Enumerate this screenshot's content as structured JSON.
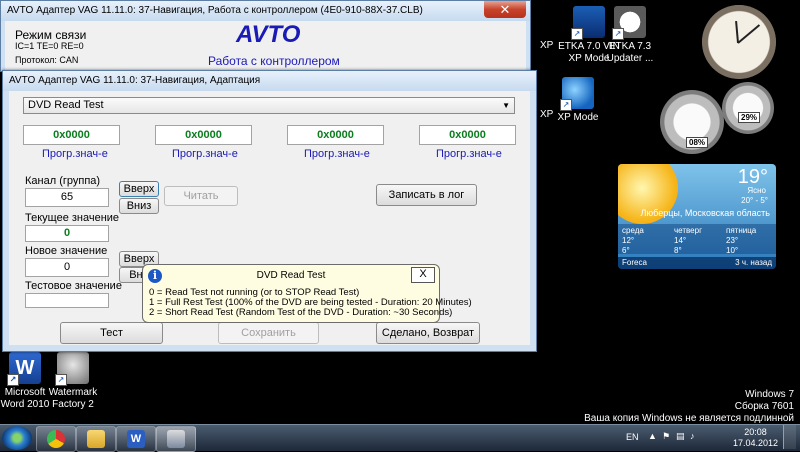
{
  "desktop": {
    "icons_top": [
      {
        "label_line1": "XP",
        "label_line2": ""
      },
      {
        "label_line1": "ETKA 7.0 VIN",
        "label_line2": "XP Mode"
      },
      {
        "label_line1": "ETKA 7.3",
        "label_line2": "Updater ..."
      }
    ],
    "icons_mid": [
      {
        "label": "XP"
      },
      {
        "label": "XP Mode"
      }
    ],
    "icons_bottom": [
      {
        "label_line1": "Microsoft",
        "label_line2": "Word 2010"
      },
      {
        "label_line1": "Watermark",
        "label_line2": "Factory 2"
      }
    ],
    "watermark": {
      "line1": "Windows 7",
      "line2": "Сборка 7601",
      "line3": "Ваша копия Windows не является подлинной"
    }
  },
  "gadgets": {
    "meter1_pct": "08%",
    "meter2_pct": "29%",
    "weather": {
      "temp": "19°",
      "condition": "Ясно",
      "range": "20° - 5°",
      "city": "Люберцы, Московская область",
      "days": [
        {
          "name": "среда",
          "hi": "12°",
          "lo": "6°"
        },
        {
          "name": "четверг",
          "hi": "14°",
          "lo": "8°"
        },
        {
          "name": "пятница",
          "hi": "23°",
          "lo": "10°"
        }
      ],
      "provider": "Foreca",
      "updated": "3 ч. назад"
    }
  },
  "taskbar": {
    "lang": "EN",
    "time": "20:08",
    "date": "17.04.2012"
  },
  "back_window": {
    "title": "AVTO Адаптер VAG 11.11.0: 37-Навигация,  Работа с контроллером (4E0-910-88X-37.CLB)",
    "conn_label": "Режим связи",
    "conn_values": "IC=1  TE=0  RE=0",
    "protocol": "Протокол: CAN",
    "logo": "AVTO",
    "subtitle": "Работа с контроллером"
  },
  "front_window": {
    "title": "AVTO Адаптер VAG 11.11.0: 37-Навигация,  Адаптация",
    "dropdown_value": "DVD Read Test",
    "values": [
      {
        "value": "0x0000",
        "caption": "Прогр.знач-е"
      },
      {
        "value": "0x0000",
        "caption": "Прогр.знач-е"
      },
      {
        "value": "0x0000",
        "caption": "Прогр.знач-е"
      },
      {
        "value": "0x0000",
        "caption": "Прогр.знач-е"
      }
    ],
    "channel_label": "Канал (группа)",
    "channel_value": "65",
    "up_label": "Вверх",
    "down_label": "Вниз",
    "read_label": "Читать",
    "log_label": "Записать в лог",
    "current_label": "Текущее значение",
    "current_value": "0",
    "new_label": "Новое значение",
    "new_value": "0",
    "up2_label": "Вверх",
    "down2_label": "Вни",
    "test_value_label": "Тестовое значение",
    "test_value": "",
    "test_button": "Тест",
    "save_button": "Сохранить",
    "done_button": "Сделано, Возврат"
  },
  "tooltip": {
    "title": "DVD Read Test",
    "close": "X",
    "lines": [
      "0 = Read Test not running (or to STOP Read Test)",
      "1 = Full Rest Test (100% of the DVD are being tested - Duration: 20 Minutes)",
      "2 = Short Read Test  (Random Test of the DVD - Duration: ~30 Seconds)"
    ]
  }
}
